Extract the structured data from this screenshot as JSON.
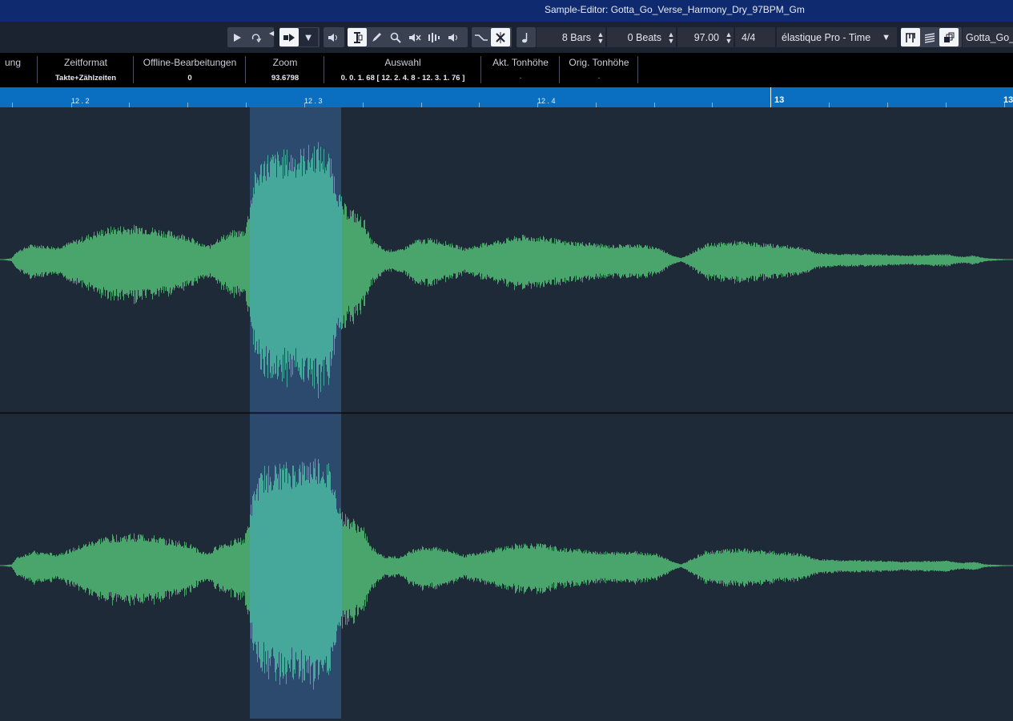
{
  "window": {
    "title": "Sample-Editor: Gotta_Go_Verse_Harmony_Dry_97BPM_Gm"
  },
  "toolbar": {
    "icons": [
      "play-icon",
      "loop-icon",
      "autoscroll-icon",
      "dropdown-icon",
      "speaker-icon",
      "range-select-icon",
      "pencil-icon",
      "zoom-icon",
      "mute-icon",
      "warp-icon",
      "play-tool-icon",
      "snap-icon",
      "zero-crossing-icon",
      "note-icon"
    ],
    "length_bars": "8 Bars",
    "length_beats": "0 Beats",
    "tempo": "97.00",
    "signature": "4/4",
    "algorithm": "élastique Pro - Time",
    "clip_name": "Gotta_Go_"
  },
  "infoline": {
    "columns": [
      {
        "label": "ung",
        "value": ""
      },
      {
        "label": "Zeitformat",
        "value": "Takte+Zählzeiten"
      },
      {
        "label": "Offline-Bearbeitungen",
        "value": "0"
      },
      {
        "label": "Zoom",
        "value": "93.6798"
      },
      {
        "label": "Auswahl",
        "value": "0. 0. 1. 68 [ 12. 2. 4.  8 - 12. 3. 1. 76 ]"
      },
      {
        "label": "Akt. Tonhöhe",
        "value": "-"
      },
      {
        "label": "Orig. Tonhöhe",
        "value": "-"
      }
    ]
  },
  "ruler": {
    "labels": [
      "12 . 2",
      "12 . 3",
      "12 . 4",
      "13",
      "13"
    ]
  },
  "waveform": {
    "channels": [
      "left",
      "right"
    ],
    "selection": {
      "start": "12. 2. 4.  8",
      "end": "12. 3. 1. 76"
    },
    "colors": {
      "wave": "#4aa56c",
      "selected_wave": "#45a89a",
      "selection": "#2b4a6e",
      "background": "#1f2a38"
    }
  }
}
